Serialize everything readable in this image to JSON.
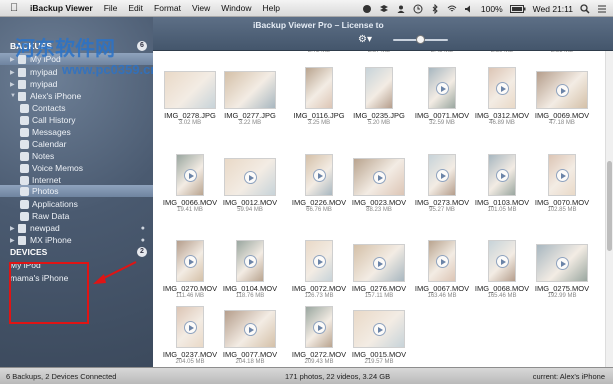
{
  "menubar": {
    "app_name": "iBackup Viewer",
    "items": [
      "File",
      "Edit",
      "Format",
      "View",
      "Window",
      "Help"
    ],
    "battery": "100%",
    "clock": "Wed 21:11"
  },
  "window": {
    "title": "iBackup Viewer Pro – License to"
  },
  "watermark": {
    "text": "河东软件网",
    "url": "www.pc0359.cn"
  },
  "sidebar": {
    "backups_header": "BACKUPS",
    "backups_count": "6",
    "devices_header": "DEVICES",
    "devices_count": "2",
    "backups": [
      {
        "label": "My iPod"
      },
      {
        "label": "myipad"
      },
      {
        "label": "myipad"
      },
      {
        "label": "Alex's iPhone"
      }
    ],
    "apps": [
      "Contacts",
      "Call History",
      "Messages",
      "Calendar",
      "Notes",
      "Voice Memos",
      "Internet",
      "Photos",
      "Applications",
      "Raw Data"
    ],
    "more_backups": [
      "newpad",
      "MX iPhone"
    ],
    "devices": [
      "My iPod",
      "mama's iPhone"
    ]
  },
  "top_row_sizes": [
    "2.72 MB",
    "2.87 MB",
    "2.45 MB",
    "2.39 MB",
    "2.51 MB",
    "2.22 MB"
  ],
  "items": [
    {
      "name": "IMG_0278.JPG",
      "size": "3.02 MB"
    },
    {
      "name": "IMG_0277.JPG",
      "size": "3.22 MB"
    },
    {
      "name": "IMG_0116.JPG",
      "size": "3.25 MB"
    },
    {
      "name": "IMG_0235.JPG",
      "size": "5.20 MB"
    },
    {
      "name": "IMG_0071.MOV",
      "size": "32.59 MB"
    },
    {
      "name": "IMG_0312.MOV",
      "size": "46.89 MB"
    },
    {
      "name": "IMG_0069.MOV",
      "size": "47.18 MB"
    },
    {
      "name": "IMG_0066.MOV",
      "size": "19.41 MB"
    },
    {
      "name": "IMG_0012.MOV",
      "size": "59.94 MB"
    },
    {
      "name": "IMG_0226.MOV",
      "size": "66.76 MB"
    },
    {
      "name": "IMG_0023.MOV",
      "size": "88.23 MB"
    },
    {
      "name": "IMG_0273.MOV",
      "size": "95.27 MB"
    },
    {
      "name": "IMG_0103.MOV",
      "size": "101.05 MB"
    },
    {
      "name": "IMG_0070.MOV",
      "size": "102.85 MB"
    },
    {
      "name": "IMG_0270.MOV",
      "size": "111.46 MB"
    },
    {
      "name": "IMG_0104.MOV",
      "size": "118.76 MB"
    },
    {
      "name": "IMG_0072.MOV",
      "size": "126.73 MB"
    },
    {
      "name": "IMG_0276.MOV",
      "size": "157.11 MB"
    },
    {
      "name": "IMG_0067.MOV",
      "size": "163.46 MB"
    },
    {
      "name": "IMG_0068.MOV",
      "size": "165.46 MB"
    },
    {
      "name": "IMG_0275.MOV",
      "size": "192.99 MB"
    },
    {
      "name": "IMG_0237.MOV",
      "size": "204.05 MB"
    },
    {
      "name": "IMG_0077.MOV",
      "size": "204.18 MB"
    },
    {
      "name": "IMG_0272.MOV",
      "size": "209.43 MB"
    },
    {
      "name": "IMG_0015.MOV",
      "size": "219.57 MB"
    }
  ],
  "status": {
    "left": "6 Backups, 2 Devices Connected",
    "middle": "171 photos, 22 videos, 3.24 GB",
    "right": "current: Alex's iPhone"
  },
  "colors": {
    "highlight_box": "#e01414",
    "sidebar_bg": "#4a5a70",
    "toolbar_bg": "#52647b"
  }
}
